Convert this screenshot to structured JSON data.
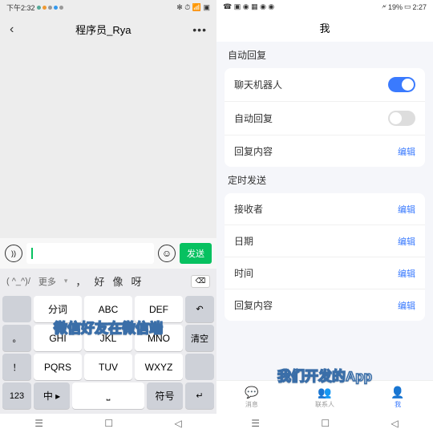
{
  "left": {
    "status": {
      "time": "下午2:32",
      "icons": "✻ ⏱ 📶 ▣"
    },
    "nav": {
      "back": "‹",
      "title": "程序员_Rya",
      "more": "•••"
    },
    "input": {
      "send": "发送"
    },
    "suggest": {
      "preset": "( ^_^)/",
      "more": "更多",
      "w1": "，",
      "w2": "好",
      "w3": "像",
      "w4": "呀"
    },
    "keys": {
      "r1": [
        "",
        "分词",
        "ABC",
        "DEF",
        "↶"
      ],
      "r2": [
        "。",
        "GHI",
        "JKL",
        "MNO",
        "清空"
      ],
      "r3": [
        "！",
        "PQRS",
        "TUV",
        "WXYZ",
        ""
      ],
      "r4": [
        "123",
        "中 ▸",
        "⎵",
        "符号",
        "↵"
      ]
    },
    "overlay": "微信好友在微信端"
  },
  "right": {
    "status": {
      "time": "2:27",
      "battery": "19%"
    },
    "title": "我",
    "s1": "自动回复",
    "s2": "定时发送",
    "rows1": [
      {
        "lbl": "聊天机器人",
        "toggle": "on"
      },
      {
        "lbl": "自动回复",
        "toggle": "off"
      },
      {
        "lbl": "回复内容",
        "act": "编辑"
      }
    ],
    "rows2": [
      {
        "lbl": "接收者",
        "act": "编辑"
      },
      {
        "lbl": "日期",
        "act": "编辑"
      },
      {
        "lbl": "时间",
        "act": "编辑"
      },
      {
        "lbl": "回复内容",
        "act": "编辑"
      }
    ],
    "tabs": [
      {
        "ico": "💬",
        "lbl": "消息"
      },
      {
        "ico": "👥",
        "lbl": "联系人"
      },
      {
        "ico": "👤",
        "lbl": "我"
      }
    ],
    "overlay": "我们开发的App"
  }
}
